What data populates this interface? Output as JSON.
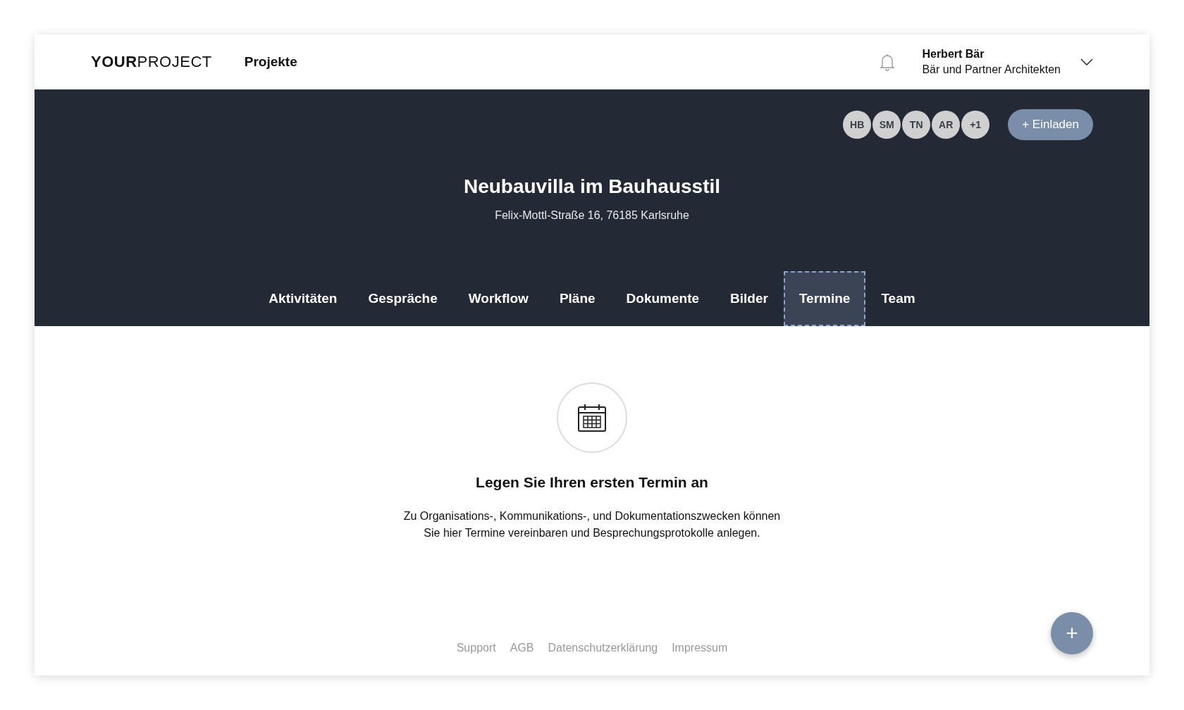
{
  "header": {
    "logo_bold": "YOUR",
    "logo_light": "PROJECT",
    "nav_link": "Projekte",
    "user_name": "Herbert Bär",
    "user_company": "Bär und Partner Architekten"
  },
  "project": {
    "members": [
      "HB",
      "SM",
      "TN",
      "AR",
      "+1"
    ],
    "invite_button": "+ Einladen",
    "title": "Neubauvilla im Bauhausstil",
    "address": "Felix-Mottl-Straße 16, 76185 Karlsruhe"
  },
  "tabs": [
    {
      "label": "Aktivitäten",
      "selected": false
    },
    {
      "label": "Gespräche",
      "selected": false
    },
    {
      "label": "Workflow",
      "selected": false
    },
    {
      "label": "Pläne",
      "selected": false
    },
    {
      "label": "Dokumente",
      "selected": false
    },
    {
      "label": "Bilder",
      "selected": false
    },
    {
      "label": "Termine",
      "selected": true
    },
    {
      "label": "Team",
      "selected": false
    }
  ],
  "empty_state": {
    "heading": "Legen Sie Ihren ersten Termin an",
    "text_line_1": "Zu Organisations-, Kommunikations-, und Dokumentationszwecken können",
    "text_line_2": "Sie hier Termine vereinbaren und Besprechungsprotokolle anlegen."
  },
  "footer_links": [
    "Support",
    "AGB",
    "Datenschutzerklärung",
    "Impressum"
  ],
  "fab": {
    "label": "+"
  }
}
